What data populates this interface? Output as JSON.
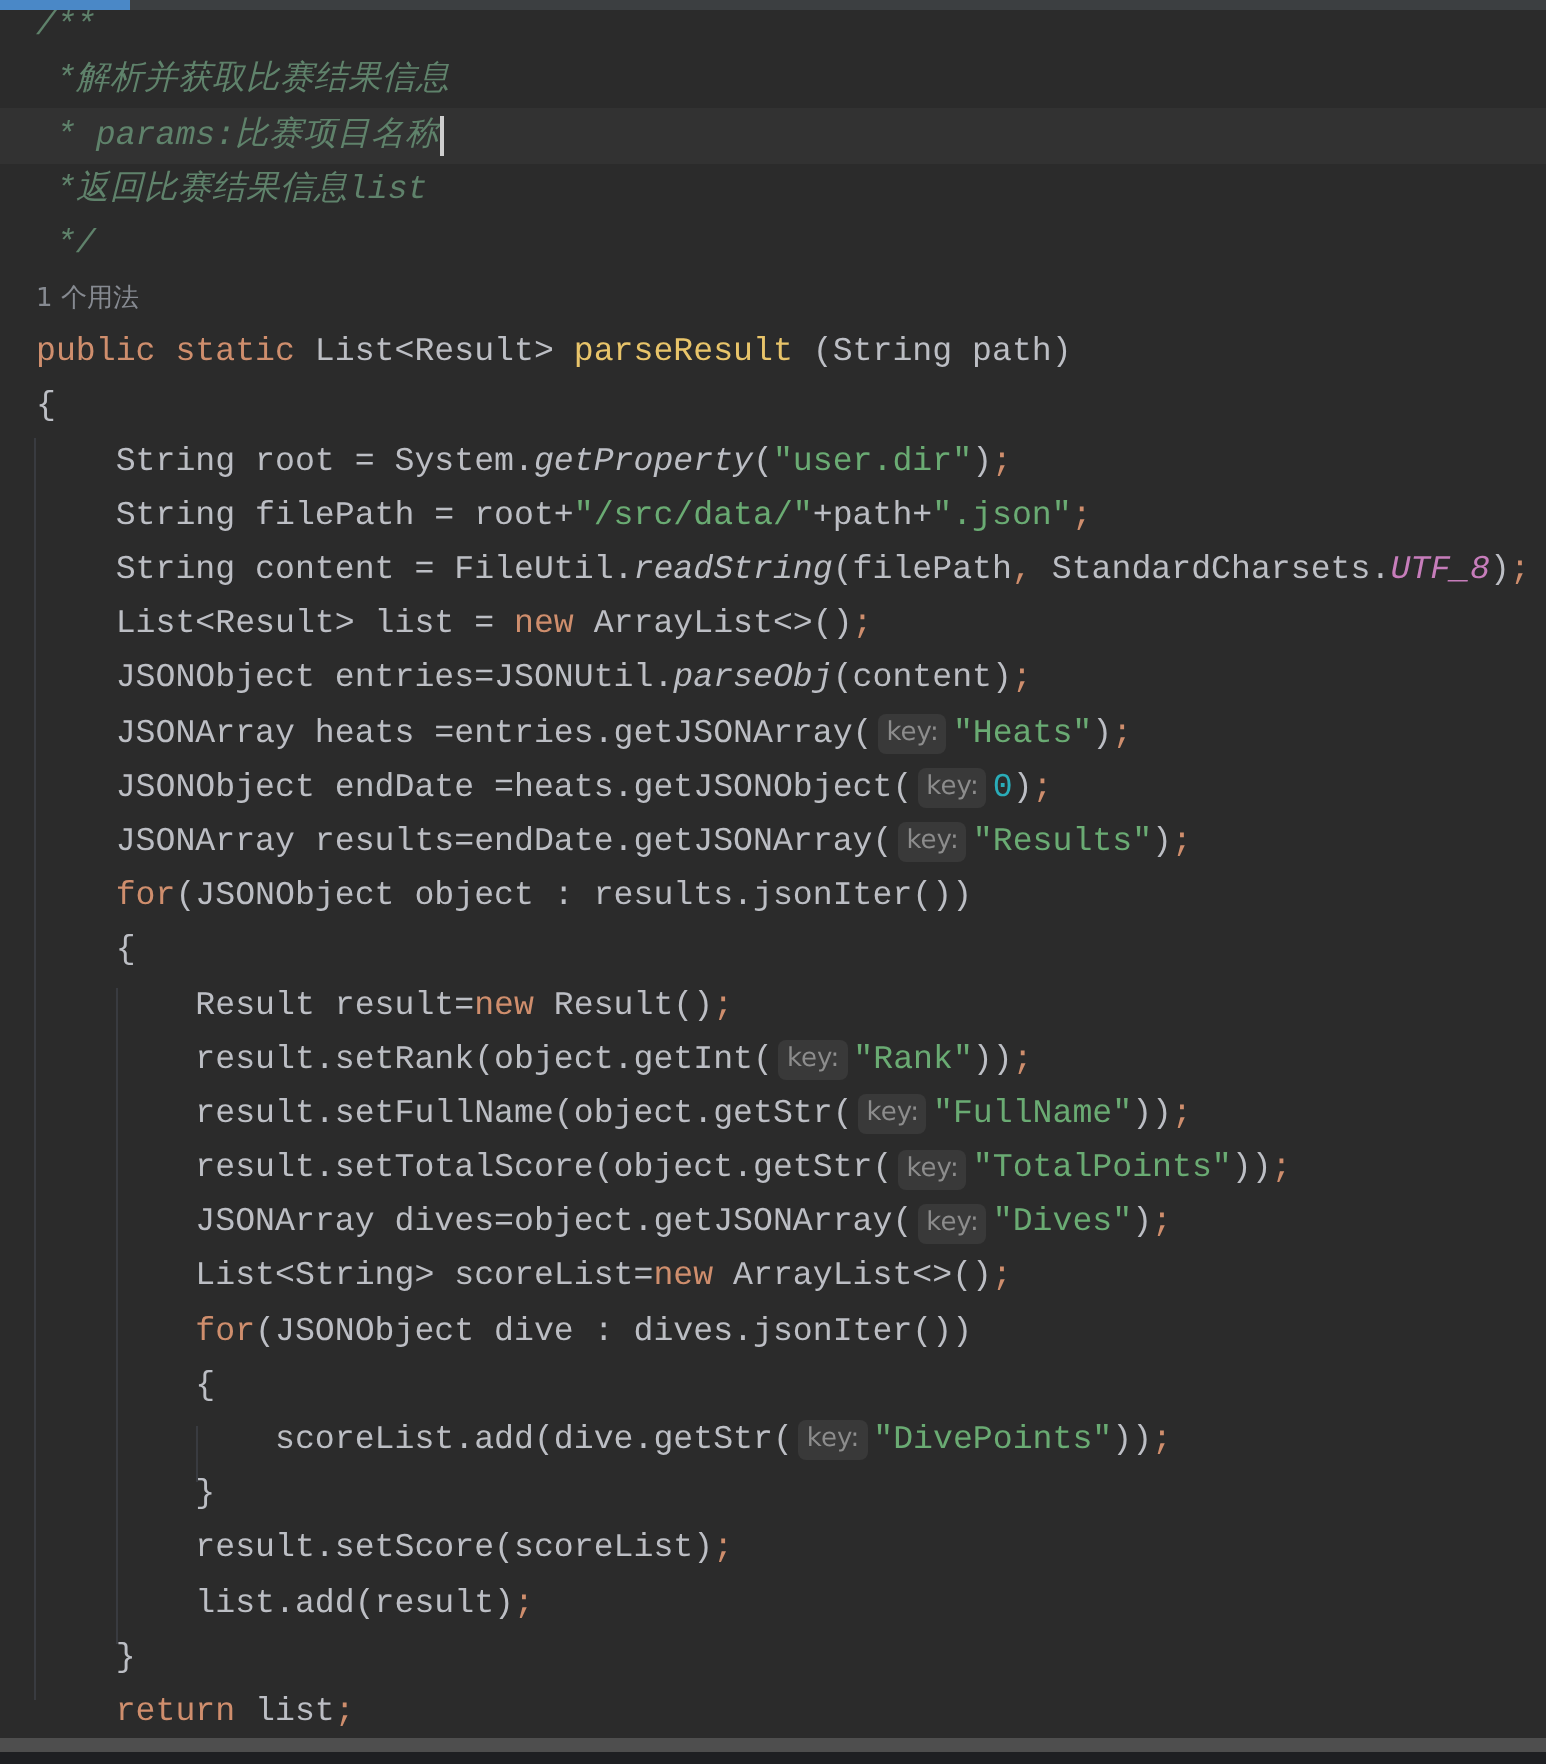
{
  "editor": {
    "lines": [
      {
        "current": false,
        "tokens": [
          {
            "kind": "comment",
            "text": "/**"
          }
        ]
      },
      {
        "current": false,
        "tokens": [
          {
            "kind": "comment",
            "text": " *解析并获取比赛结果信息"
          }
        ]
      },
      {
        "current": true,
        "tokens": [
          {
            "kind": "comment",
            "text": " * params:比赛项目名称"
          }
        ]
      },
      {
        "current": false,
        "tokens": [
          {
            "kind": "comment",
            "text": " *返回比赛结果信息list"
          }
        ]
      },
      {
        "current": false,
        "tokens": [
          {
            "kind": "comment",
            "text": " */"
          }
        ]
      },
      {
        "current": false,
        "tokens": [
          {
            "kind": "usage",
            "text": "1 个用法"
          }
        ]
      },
      {
        "current": false,
        "tokens": [
          {
            "kind": "keyword",
            "text": "public static "
          },
          {
            "kind": "plain",
            "text": "List<Result> "
          },
          {
            "kind": "declaration",
            "text": "parseResult"
          },
          {
            "kind": "plain",
            "text": " (String path)"
          }
        ]
      },
      {
        "current": false,
        "tokens": [
          {
            "kind": "plain",
            "text": "{"
          }
        ]
      },
      {
        "current": false,
        "tokens": [
          {
            "kind": "plain",
            "text": "    String root = System."
          },
          {
            "kind": "call",
            "text": "getProperty"
          },
          {
            "kind": "plain",
            "text": "("
          },
          {
            "kind": "string",
            "text": "\"user.dir\""
          },
          {
            "kind": "plain",
            "text": ")"
          },
          {
            "kind": "keyword",
            "text": ";"
          }
        ]
      },
      {
        "current": false,
        "tokens": [
          {
            "kind": "plain",
            "text": "    String filePath = root+"
          },
          {
            "kind": "string",
            "text": "\"/src/data/\""
          },
          {
            "kind": "plain",
            "text": "+path+"
          },
          {
            "kind": "string",
            "text": "\".json\""
          },
          {
            "kind": "keyword",
            "text": ";"
          }
        ]
      },
      {
        "current": false,
        "tokens": [
          {
            "kind": "plain",
            "text": "    String content = FileUtil."
          },
          {
            "kind": "call",
            "text": "readString"
          },
          {
            "kind": "plain",
            "text": "(filePath"
          },
          {
            "kind": "keyword",
            "text": ","
          },
          {
            "kind": "plain",
            "text": " StandardCharsets."
          },
          {
            "kind": "constant",
            "text": "UTF_8"
          },
          {
            "kind": "plain",
            "text": ")"
          },
          {
            "kind": "keyword",
            "text": ";"
          }
        ]
      },
      {
        "current": false,
        "tokens": [
          {
            "kind": "plain",
            "text": "    List<Result> list = "
          },
          {
            "kind": "keyword",
            "text": "new"
          },
          {
            "kind": "plain",
            "text": " ArrayList<>()"
          },
          {
            "kind": "keyword",
            "text": ";"
          }
        ]
      },
      {
        "current": false,
        "tokens": [
          {
            "kind": "plain",
            "text": "    JSONObject entries=JSONUtil."
          },
          {
            "kind": "call",
            "text": "parseObj"
          },
          {
            "kind": "plain",
            "text": "(content)"
          },
          {
            "kind": "keyword",
            "text": ";"
          }
        ]
      },
      {
        "current": false,
        "tokens": [
          {
            "kind": "plain",
            "text": "    JSONArray heats =entries.getJSONArray("
          },
          {
            "kind": "hint",
            "text": "key:"
          },
          {
            "kind": "string",
            "text": "\"Heats\""
          },
          {
            "kind": "plain",
            "text": ")"
          },
          {
            "kind": "keyword",
            "text": ";"
          }
        ]
      },
      {
        "current": false,
        "tokens": [
          {
            "kind": "plain",
            "text": "    JSONObject endDate =heats.getJSONObject("
          },
          {
            "kind": "hint",
            "text": "key:"
          },
          {
            "kind": "number",
            "text": "0"
          },
          {
            "kind": "plain",
            "text": ")"
          },
          {
            "kind": "keyword",
            "text": ";"
          }
        ]
      },
      {
        "current": false,
        "tokens": [
          {
            "kind": "plain",
            "text": "    JSONArray results=endDate.getJSONArray("
          },
          {
            "kind": "hint",
            "text": "key:"
          },
          {
            "kind": "string",
            "text": "\"Results\""
          },
          {
            "kind": "plain",
            "text": ")"
          },
          {
            "kind": "keyword",
            "text": ";"
          }
        ]
      },
      {
        "current": false,
        "tokens": [
          {
            "kind": "keyword",
            "text": "    for"
          },
          {
            "kind": "plain",
            "text": "(JSONObject object : results.jsonIter())"
          }
        ]
      },
      {
        "current": false,
        "tokens": [
          {
            "kind": "plain",
            "text": "    {"
          }
        ]
      },
      {
        "current": false,
        "tokens": [
          {
            "kind": "plain",
            "text": "        Result result="
          },
          {
            "kind": "keyword",
            "text": "new"
          },
          {
            "kind": "plain",
            "text": " Result()"
          },
          {
            "kind": "keyword",
            "text": ";"
          }
        ]
      },
      {
        "current": false,
        "tokens": [
          {
            "kind": "plain",
            "text": "        result.setRank(object.getInt("
          },
          {
            "kind": "hint",
            "text": "key:"
          },
          {
            "kind": "string",
            "text": "\"Rank\""
          },
          {
            "kind": "plain",
            "text": "))"
          },
          {
            "kind": "keyword",
            "text": ";"
          }
        ]
      },
      {
        "current": false,
        "tokens": [
          {
            "kind": "plain",
            "text": "        result.setFullName(object.getStr("
          },
          {
            "kind": "hint",
            "text": "key:"
          },
          {
            "kind": "string",
            "text": "\"FullName\""
          },
          {
            "kind": "plain",
            "text": "))"
          },
          {
            "kind": "keyword",
            "text": ";"
          }
        ]
      },
      {
        "current": false,
        "tokens": [
          {
            "kind": "plain",
            "text": "        result.setTotalScore(object.getStr("
          },
          {
            "kind": "hint",
            "text": "key:"
          },
          {
            "kind": "string",
            "text": "\"TotalPoints\""
          },
          {
            "kind": "plain",
            "text": "))"
          },
          {
            "kind": "keyword",
            "text": ";"
          }
        ]
      },
      {
        "current": false,
        "tokens": [
          {
            "kind": "plain",
            "text": "        JSONArray dives=object.getJSONArray("
          },
          {
            "kind": "hint",
            "text": "key:"
          },
          {
            "kind": "string",
            "text": "\"Dives\""
          },
          {
            "kind": "plain",
            "text": ")"
          },
          {
            "kind": "keyword",
            "text": ";"
          }
        ]
      },
      {
        "current": false,
        "tokens": [
          {
            "kind": "plain",
            "text": "        List<String> scoreList="
          },
          {
            "kind": "keyword",
            "text": "new"
          },
          {
            "kind": "plain",
            "text": " ArrayList<>()"
          },
          {
            "kind": "keyword",
            "text": ";"
          }
        ]
      },
      {
        "current": false,
        "tokens": [
          {
            "kind": "keyword",
            "text": "        for"
          },
          {
            "kind": "plain",
            "text": "(JSONObject dive : dives.jsonIter())"
          }
        ]
      },
      {
        "current": false,
        "tokens": [
          {
            "kind": "plain",
            "text": "        {"
          }
        ]
      },
      {
        "current": false,
        "tokens": [
          {
            "kind": "plain",
            "text": "            scoreList.add(dive.getStr("
          },
          {
            "kind": "hint",
            "text": "key:"
          },
          {
            "kind": "string",
            "text": "\"DivePoints\""
          },
          {
            "kind": "plain",
            "text": "))"
          },
          {
            "kind": "keyword",
            "text": ";"
          }
        ]
      },
      {
        "current": false,
        "tokens": [
          {
            "kind": "plain",
            "text": "        }"
          }
        ]
      },
      {
        "current": false,
        "tokens": [
          {
            "kind": "plain",
            "text": "        result.setScore(scoreList)"
          },
          {
            "kind": "keyword",
            "text": ";"
          }
        ]
      },
      {
        "current": false,
        "tokens": [
          {
            "kind": "plain",
            "text": "        list.add(result)"
          },
          {
            "kind": "keyword",
            "text": ";"
          }
        ]
      },
      {
        "current": false,
        "tokens": [
          {
            "kind": "plain",
            "text": "    }"
          }
        ]
      },
      {
        "current": false,
        "tokens": [
          {
            "kind": "keyword",
            "text": "    return"
          },
          {
            "kind": "plain",
            "text": " list"
          },
          {
            "kind": "keyword",
            "text": ";"
          }
        ]
      }
    ]
  }
}
